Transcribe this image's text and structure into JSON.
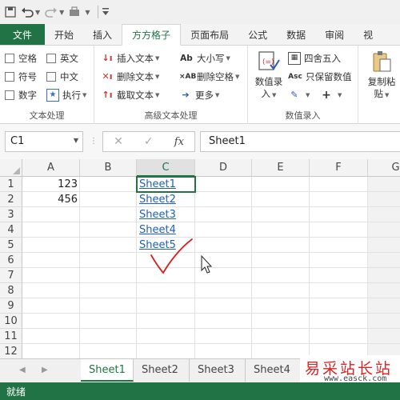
{
  "quick_access": {
    "icons": [
      "save-icon",
      "undo-icon",
      "redo-icon",
      "more-tools-icon",
      "customize-icon"
    ]
  },
  "ribbon_tabs": [
    "文件",
    "开始",
    "插入",
    "方方格子",
    "页面布局",
    "公式",
    "数据",
    "审阅",
    "视"
  ],
  "ribbon": {
    "text_group": {
      "label": "文本处理",
      "items": [
        "空格",
        "英文",
        "符号",
        "中文",
        "数字"
      ],
      "run_label": "执行"
    },
    "advanced_group": {
      "label": "高级文本处理",
      "items": [
        "插入文本",
        "删除文本",
        "截取文本",
        "大小写",
        "删除空格",
        "更多"
      ]
    },
    "entry_group": {
      "label": "数值录入",
      "big_button_line1": "数值录",
      "big_button_line2": "入",
      "round_label": "四舍五入",
      "keep_value_label": "只保留数值",
      "asc_label": "Asc"
    },
    "paste_group": {
      "line1": "复制粘",
      "line2": "贴"
    }
  },
  "formula_bar": {
    "name_box": "C1",
    "fx_label": "fx",
    "content": "Sheet1"
  },
  "columns": [
    "A",
    "B",
    "C",
    "D",
    "E",
    "F",
    "G"
  ],
  "rows": [
    "1",
    "2",
    "3",
    "4",
    "5",
    "6",
    "7",
    "8",
    "9",
    "10",
    "11",
    "12"
  ],
  "cells": {
    "A1": "123",
    "A2": "456",
    "C1": "Sheet1",
    "C2": "Sheet2",
    "C3": "Sheet3",
    "C4": "Sheet4",
    "C5": "Sheet5"
  },
  "sheet_tabs": [
    "Sheet1",
    "Sheet2",
    "Sheet3",
    "Sheet4"
  ],
  "active_sheet": "Sheet1",
  "status": {
    "text": "就绪"
  },
  "watermark": {
    "main": "易采站长站",
    "url": "www.easck.com"
  },
  "colors": {
    "accent": "#217346",
    "link": "#1f5fbf",
    "annotation": "#d22222"
  }
}
